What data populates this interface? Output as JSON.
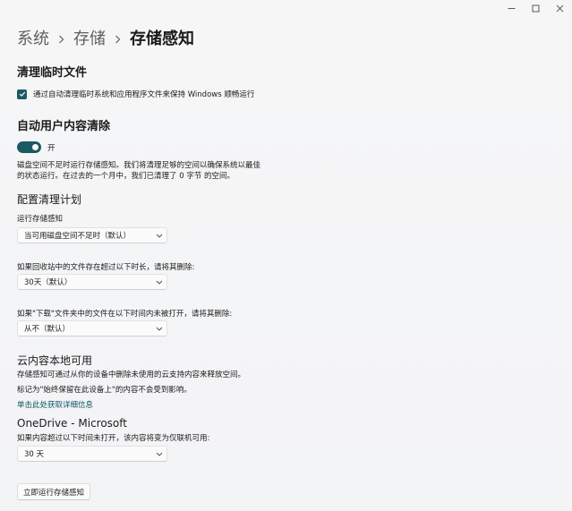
{
  "window": {
    "controls": {
      "minimize": "minimize-icon",
      "maximize": "maximize-icon",
      "close": "close-icon"
    }
  },
  "breadcrumb": {
    "items": [
      "系统",
      "存储"
    ],
    "current": "存储感知"
  },
  "temp_files": {
    "title": "清理临时文件",
    "checkbox_label": "通过自动清理临时系统和应用程序文件来保持 Windows 顺畅运行",
    "checked": true
  },
  "auto_cleanup": {
    "title": "自动用户内容清除",
    "toggle_label": "开",
    "toggle_on": true,
    "description_line1": "磁盘空间不足时运行存储感知。我们将清理足够的空间以确保系统以最佳",
    "description_line2": "的状态运行。在过去的一个月中，我们已清理了 0 字节 的空间。"
  },
  "schedule": {
    "title": "配置清理计划",
    "run_label": "运行存储感知",
    "run_value": "当可用磁盘空间不足时（默认）",
    "recycle_label": "如果回收站中的文件存在超过以下时长，请将其删除:",
    "recycle_value": "30天（默认）",
    "downloads_label": "如果\"下载\"文件夹中的文件在以下时间内未被打开，请将其删除:",
    "downloads_value": "从不（默认）"
  },
  "cloud": {
    "title": "云内容本地可用",
    "desc1": "存储感知可通过从你的设备中删除未使用的云支持内容来释放空间。",
    "desc2": "标记为\"始终保留在此设备上\"的内容不会受到影响。",
    "link": "单击此处获取详细信息"
  },
  "onedrive": {
    "title": "OneDrive - Microsoft",
    "label": "如果内容超过以下时间未打开，该内容将变为仅联机可用:",
    "value": "30 天"
  },
  "actions": {
    "run_now": "立即运行存储感知"
  },
  "colors": {
    "accent": "#1b5a62",
    "link": "#0b5563",
    "background": "#f3f4f5"
  }
}
